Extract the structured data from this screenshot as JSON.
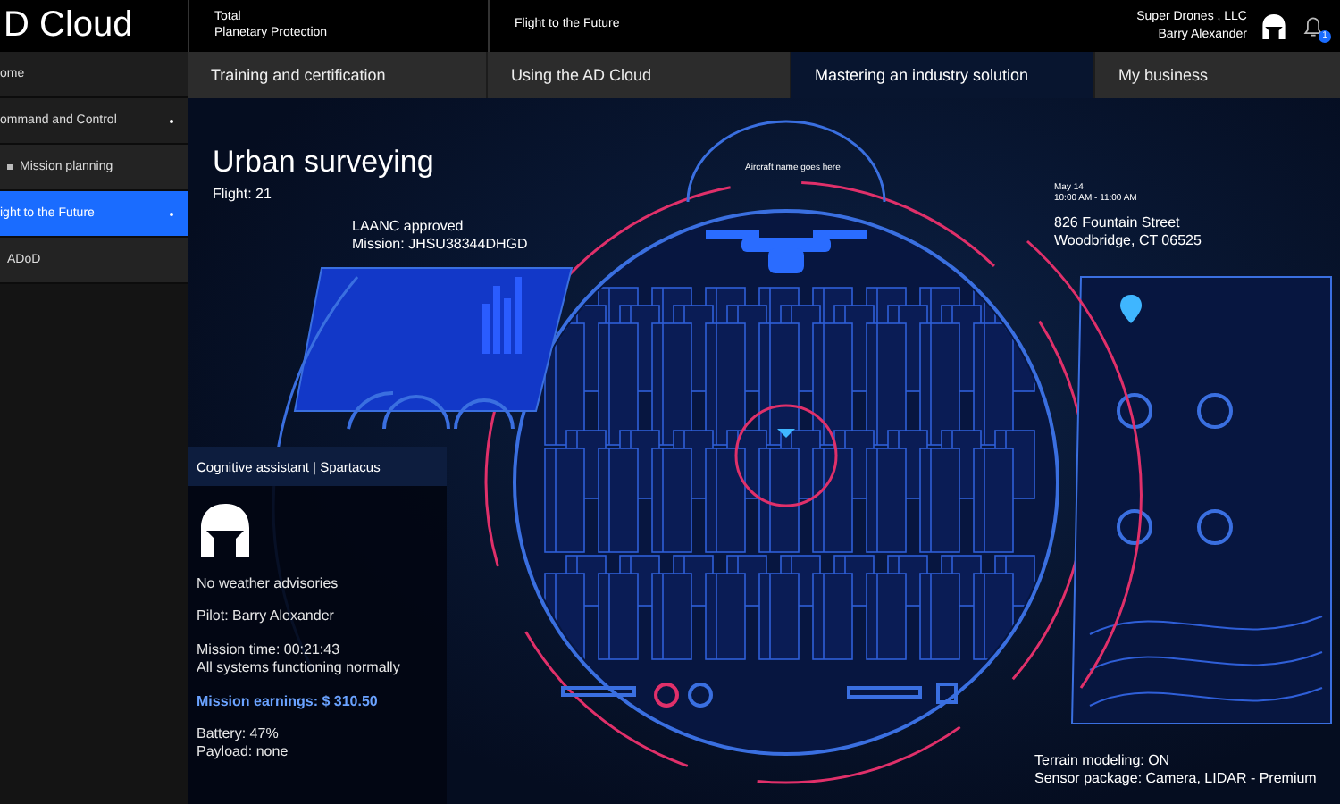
{
  "header": {
    "logo": "D Cloud",
    "program": "Total\nPlanetary Protection",
    "course": "Flight to the Future",
    "company": "Super Drones , LLC",
    "user": "Barry Alexander",
    "notification_count": "1"
  },
  "sidebar": {
    "items": [
      {
        "label": "ome",
        "selected": false,
        "dot": false
      },
      {
        "label": "ommand and Control",
        "selected": false,
        "dot": true,
        "children": [
          {
            "label": "Mission planning",
            "selected": false,
            "dot": false
          }
        ]
      },
      {
        "label": "ight to the Future",
        "selected": true,
        "dot": true,
        "children": [
          {
            "label": "ADoD",
            "selected": false,
            "dot": false
          }
        ]
      }
    ]
  },
  "tabs": [
    {
      "label": "Training and certification",
      "selected": false
    },
    {
      "label": "Using the AD Cloud",
      "selected": false
    },
    {
      "label": "Mastering an industry solution",
      "selected": true
    },
    {
      "label": "My business",
      "selected": false
    }
  ],
  "mission": {
    "title": "Urban surveying",
    "flight": "Flight: 21",
    "laanc": "LAANC approved",
    "mission_id": "Mission: JHSU38344DHGD",
    "aircraft_name": "Aircraft name goes here",
    "date": "May 14",
    "time": "10:00 AM - 11:00 AM",
    "address_1": "826 Fountain Street",
    "address_2": "Woodbridge, CT 06525",
    "terrain": "Terrain modeling: ON",
    "sensor": "Sensor package: Camera, LIDAR - Premium"
  },
  "assistant": {
    "title": "Cognitive assistant | Spartacus",
    "lines": [
      {
        "text": "No weather advisories",
        "kind": "plain"
      },
      {
        "text": "Pilot: Barry Alexander",
        "kind": "plain"
      },
      {
        "text": "Mission time: 00:21:43\nAll systems functioning normally",
        "kind": "plain"
      },
      {
        "text": "Mission earnings: $ 310.50",
        "kind": "highlight"
      },
      {
        "text": "Battery: 47%\nPayload: none",
        "kind": "plain"
      }
    ]
  }
}
